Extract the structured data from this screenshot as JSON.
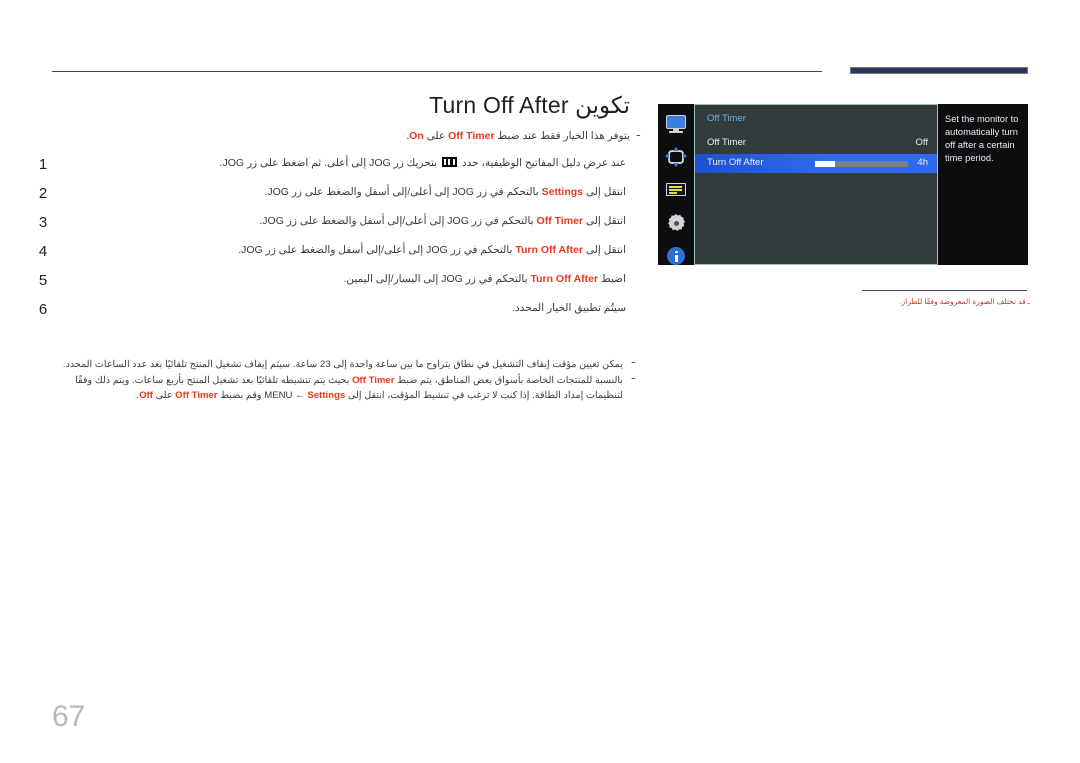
{
  "document": {
    "title": "تكوين Turn Off After",
    "page_number": "67",
    "subnote": {
      "dash": "ـ",
      "prefix": "يتوفر هذا الخيار فقط عند ضبط ",
      "kw1": "Off Timer",
      "mid": " على ",
      "kw2": "On",
      "suffix": "."
    }
  },
  "steps": [
    {
      "num": "1",
      "parts": [
        {
          "t": "عند عرض دليل المفاتيح الوظيفية، حدد ",
          "k": false
        },
        {
          "t": "ICON",
          "k": "icon"
        },
        {
          "t": " بتحريك زر JOG إلى أعلى. ثم اضغط على زر JOG.",
          "k": false
        }
      ]
    },
    {
      "num": "2",
      "parts": [
        {
          "t": "انتقل إلى ",
          "k": false
        },
        {
          "t": "Settings",
          "k": true
        },
        {
          "t": " بالتحكم في زر JOG إلى أعلى/إلى أسفل والضغط على زر JOG.",
          "k": false
        }
      ]
    },
    {
      "num": "3",
      "parts": [
        {
          "t": "انتقل إلى ",
          "k": false
        },
        {
          "t": "Off Timer",
          "k": true
        },
        {
          "t": " بالتحكم في زر JOG إلى أعلى/إلى أسفل والضغط على زر JOG.",
          "k": false
        }
      ]
    },
    {
      "num": "4",
      "parts": [
        {
          "t": "انتقل إلى ",
          "k": false
        },
        {
          "t": "Turn Off After",
          "k": true
        },
        {
          "t": " بالتحكم في زر JOG إلى أعلى/إلى أسفل والضغط على زر JOG.",
          "k": false
        }
      ]
    },
    {
      "num": "5",
      "parts": [
        {
          "t": "اضبط ",
          "k": false
        },
        {
          "t": "Turn Off After",
          "k": true
        },
        {
          "t": " بالتحكم في زر JOG إلى اليسار/إلى اليمين.",
          "k": false
        }
      ]
    },
    {
      "num": "6",
      "parts": [
        {
          "t": "سيتُم تطبيق الخيار المحدد.",
          "k": false
        }
      ]
    }
  ],
  "notes": [
    {
      "dash": "ـ",
      "parts": [
        {
          "t": "يمكن تعيين مؤقت إيقاف التشغيل في نطاق يتراوح ما بين ساعة واحدة إلى 23 ساعة. سيتم إيقاف تشغيل المنتج تلقائيًا بعد عدد الساعات المحدد.",
          "k": false
        }
      ]
    },
    {
      "dash": "ـ",
      "parts": [
        {
          "t": "بالنسبة للمنتجات الخاصة بأسواق بعض المناطق، يتم ضبط ",
          "k": false
        },
        {
          "t": "Off Timer",
          "k": true
        },
        {
          "t": " بحيث يتم تنشيطه تلقائيًا بعد تشغيل المنتج بأربع ساعات. ويتم ذلك وفقًا لتنظيمات إمداد الطاقة. إذا كنت لا ترغب في تنشيط المؤقت، انتقل إلى ",
          "k": false
        },
        {
          "t": "MENU",
          "k": false
        },
        {
          "t": " ← ",
          "k": false
        },
        {
          "t": "Settings",
          "k": true
        },
        {
          "t": " وقم بضبط ",
          "k": false
        },
        {
          "t": "Off Timer",
          "k": true
        },
        {
          "t": " على ",
          "k": false
        },
        {
          "t": "Off",
          "k": true
        },
        {
          "t": ".",
          "k": false
        }
      ]
    }
  ],
  "osd": {
    "sidebar_icons": [
      {
        "name": "monitor-icon"
      },
      {
        "name": "navigation-arrows-icon"
      },
      {
        "name": "onscreen-display-icon"
      },
      {
        "name": "settings-gear-icon"
      },
      {
        "name": "information-icon"
      }
    ],
    "menu_title": "Off Timer",
    "rows": [
      {
        "label": "Off Timer",
        "value": "Off",
        "selected": false,
        "slider": null
      },
      {
        "label": "Turn Off After",
        "value": "4h",
        "selected": true,
        "slider": {
          "percent": 21
        }
      }
    ],
    "description": "Set the monitor to automatically turn off after a certain time period.",
    "colors": {
      "highlight": "#2f6bf0",
      "title": "#6ab4e8",
      "panel_bg": "#343b3c",
      "panel_border": "#9fc0c2",
      "side_bg": "#0d0d0f"
    }
  },
  "caption": {
    "text": "ـ قد تختلف الصورة المعروضة وفقًا للطراز."
  }
}
